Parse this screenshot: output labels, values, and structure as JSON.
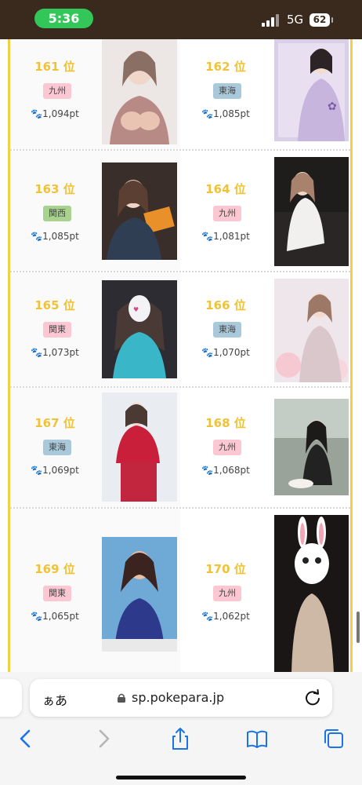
{
  "status_bar": {
    "time": "5:36",
    "network": "5G",
    "battery": "62"
  },
  "rankings": [
    {
      "rank": "161 位",
      "region": "九州",
      "region_color": "pink",
      "points": "1,094pt"
    },
    {
      "rank": "162 位",
      "region": "東海",
      "region_color": "blue",
      "points": "1,085pt"
    },
    {
      "rank": "163 位",
      "region": "関西",
      "region_color": "green",
      "points": "1,085pt"
    },
    {
      "rank": "164 位",
      "region": "九州",
      "region_color": "pink",
      "points": "1,081pt"
    },
    {
      "rank": "165 位",
      "region": "関東",
      "region_color": "pink",
      "points": "1,073pt"
    },
    {
      "rank": "166 位",
      "region": "東海",
      "region_color": "blue",
      "points": "1,070pt"
    },
    {
      "rank": "167 位",
      "region": "東海",
      "region_color": "blue",
      "points": "1,069pt"
    },
    {
      "rank": "168 位",
      "region": "九州",
      "region_color": "pink",
      "points": "1,068pt"
    },
    {
      "rank": "169 位",
      "region": "関東",
      "region_color": "pink",
      "points": "1,065pt"
    },
    {
      "rank": "170 位",
      "region": "九州",
      "region_color": "pink",
      "points": "1,062pt"
    }
  ],
  "browser": {
    "aa_label": "ぁあ",
    "url": "sp.pokepara.jp"
  },
  "colors": {
    "accent_gold": "#f0c238",
    "frame_yellow": "#f1d046",
    "ios_blue": "#1a73e8"
  }
}
